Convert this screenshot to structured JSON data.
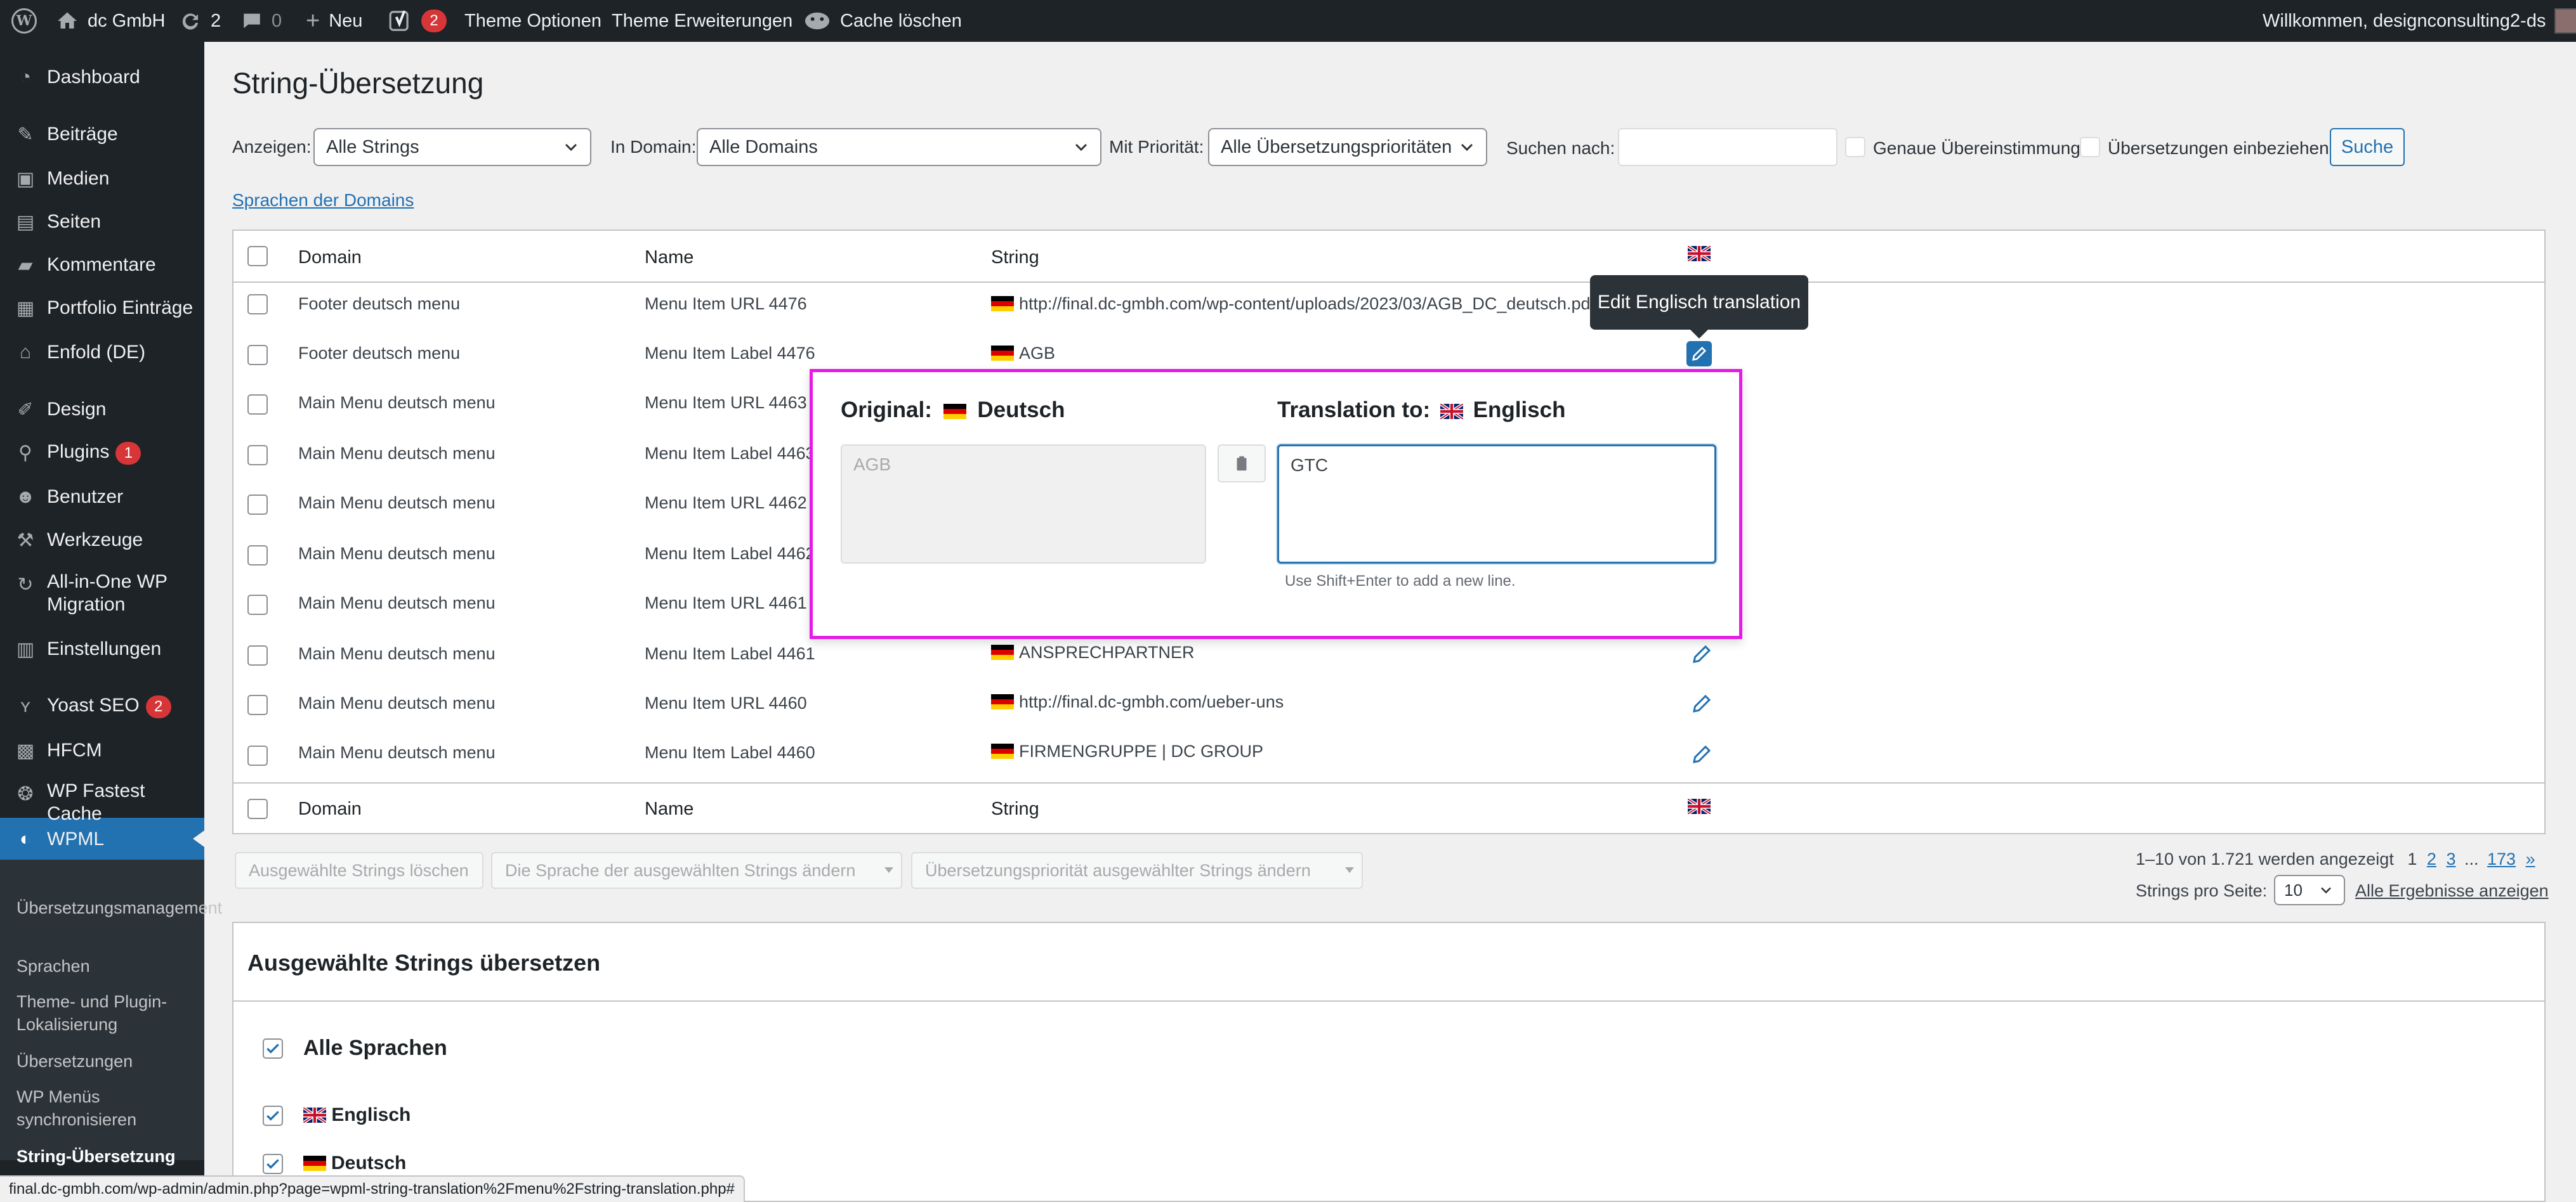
{
  "adminbar": {
    "site_name": "dc GmbH",
    "updates_count": "2",
    "comments_count": "0",
    "new_label": "Neu",
    "yoast_badge": "2",
    "theme_options": "Theme Optionen",
    "theme_extensions": "Theme Erweiterungen",
    "cache_clear": "Cache löschen",
    "welcome": "Willkommen, designconsulting2-ds"
  },
  "sidebar": {
    "items": [
      {
        "label": "Dashboard",
        "icon": "dashboard-icon"
      },
      {
        "label": "Beiträge",
        "icon": "pin-icon"
      },
      {
        "label": "Medien",
        "icon": "media-icon"
      },
      {
        "label": "Seiten",
        "icon": "pages-icon"
      },
      {
        "label": "Kommentare",
        "icon": "comment-icon"
      },
      {
        "label": "Portfolio Einträge",
        "icon": "portfolio-icon"
      },
      {
        "label": "Enfold (DE)",
        "icon": "home-icon"
      },
      {
        "label": "Design",
        "icon": "brush-icon"
      },
      {
        "label": "Plugins",
        "icon": "plugin-icon",
        "badge": "1"
      },
      {
        "label": "Benutzer",
        "icon": "user-icon"
      },
      {
        "label": "Werkzeuge",
        "icon": "wrench-icon"
      },
      {
        "label": "All-in-One WP Migration",
        "icon": "migration-icon"
      },
      {
        "label": "Einstellungen",
        "icon": "settings-icon"
      },
      {
        "label": "Yoast SEO",
        "icon": "yoast-icon",
        "badge": "2"
      },
      {
        "label": "HFCM",
        "icon": "robot-icon"
      },
      {
        "label": "WP Fastest Cache",
        "icon": "cheetah-icon"
      },
      {
        "label": "WPML",
        "icon": "wpml-icon"
      }
    ],
    "submenu": [
      "Übersetzungsmanagement",
      "Sprachen",
      "Theme- und Plugin-Lokalisierung",
      "Übersetzungen",
      "WP Menüs synchronisieren",
      "String-Übersetzung"
    ]
  },
  "page": {
    "title": "String-Übersetzung",
    "filter": {
      "show_label": "Anzeigen:",
      "show_value": "Alle Strings",
      "domain_label": "In Domain:",
      "domain_value": "Alle Domains",
      "priority_label": "Mit Priorität:",
      "priority_value": "Alle Übersetzungsprioritäten",
      "search_label": "Suchen nach:",
      "search_value": "",
      "exact_label": "Genaue Übereinstimmung",
      "include_label": "Übersetzungen einbeziehen",
      "search_button": "Suche"
    },
    "domain_languages_link": "Sprachen der Domains"
  },
  "table": {
    "headers": {
      "domain": "Domain",
      "name": "Name",
      "string": "String"
    },
    "rows": [
      {
        "domain": "Footer deutsch menu",
        "name": "Menu Item URL 4476",
        "string": "http://final.dc-gmbh.com/wp-content/uploads/2023/03/AGB_DC_deutsch.pdf"
      },
      {
        "domain": "Footer deutsch menu",
        "name": "Menu Item Label 4476",
        "string": "AGB"
      },
      {
        "domain": "Main Menu deutsch menu",
        "name": "Menu Item URL 4463",
        "string": ""
      },
      {
        "domain": "Main Menu deutsch menu",
        "name": "Menu Item Label 4463",
        "string": ""
      },
      {
        "domain": "Main Menu deutsch menu",
        "name": "Menu Item URL 4462",
        "string": ""
      },
      {
        "domain": "Main Menu deutsch menu",
        "name": "Menu Item Label 4462",
        "string": ""
      },
      {
        "domain": "Main Menu deutsch menu",
        "name": "Menu Item URL 4461",
        "string": ""
      },
      {
        "domain": "Main Menu deutsch menu",
        "name": "Menu Item Label 4461",
        "string": "ANSPRECHPARTNER"
      },
      {
        "domain": "Main Menu deutsch menu",
        "name": "Menu Item URL 4460",
        "string": "http://final.dc-gmbh.com/ueber-uns"
      },
      {
        "domain": "Main Menu deutsch menu",
        "name": "Menu Item Label 4460",
        "string": "FIRMENGRUPPE | DC GROUP"
      }
    ]
  },
  "tooltip": "Edit Englisch translation",
  "popup": {
    "original_label": "Original:",
    "original_lang": "Deutsch",
    "translation_label": "Translation to:",
    "translation_lang": "Englisch",
    "original_text": "AGB",
    "translation_text": "GTC",
    "hint": "Use Shift+Enter to add a new line."
  },
  "bulk": {
    "delete": "Ausgewählte Strings löschen",
    "change_lang": "Die Sprache der ausgewählten Strings ändern",
    "change_priority": "Übersetzungspriorität ausgewählter Strings ändern"
  },
  "pagination": {
    "summary": "1–10 von 1.721 werden angezeigt",
    "current": "1",
    "p2": "2",
    "p3": "3",
    "ellipsis": "...",
    "last": "173",
    "next": "»",
    "per_page_label": "Strings pro Seite:",
    "per_page_value": "10",
    "show_all": "Alle Ergebnisse anzeigen"
  },
  "bottom": {
    "heading": "Ausgewählte Strings übersetzen",
    "all_languages": "Alle Sprachen",
    "lang_en": "Englisch",
    "lang_de": "Deutsch"
  },
  "statusbar": "final.dc-gmbh.com/wp-admin/admin.php?page=wpml-string-translation%2Fmenu%2Fstring-translation.php#",
  "colors": {
    "accent": "#2271b1",
    "sidebar": "#1d2327",
    "highlight": "#e619e6",
    "badge": "#d63638"
  }
}
